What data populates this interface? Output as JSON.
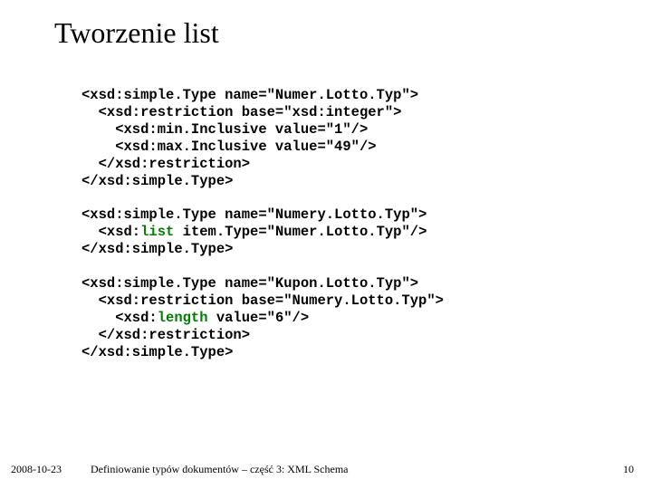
{
  "slide": {
    "title": "Tworzenie list",
    "code": {
      "l1_a": "<xsd:simple.Type name=\"Numer.Lotto.Typ\">",
      "l2_a": "  <xsd:restriction base=\"xsd:integer\">",
      "l3_a": "    <xsd:min.Inclusive value=\"1\"/>",
      "l4_a": "    <xsd:max.Inclusive value=\"49\"/>",
      "l5_a": "  </xsd:restriction>",
      "l6_a": "</xsd:simple.Type>",
      "l7_a": "<xsd:simple.Type name=\"Numery.Lotto.Typ\">",
      "l8_a": "  <xsd:",
      "l8_kw": "list",
      "l8_b": " item.Type=\"Numer.Lotto.Typ\"/>",
      "l9_a": "</xsd:simple.Type>",
      "l10_a": "<xsd:simple.Type name=\"Kupon.Lotto.Typ\">",
      "l11_a": "  <xsd:restriction base=\"Numery.Lotto.Typ\">",
      "l12_a": "    <xsd:",
      "l12_kw": "length",
      "l12_b": " value=\"6\"/>",
      "l13_a": "  </xsd:restriction>",
      "l14_a": "</xsd:simple.Type>"
    },
    "footer": {
      "date": "2008-10-23",
      "title": "Definiowanie typów dokumentów – część 3: XML Schema",
      "page": "10"
    }
  }
}
